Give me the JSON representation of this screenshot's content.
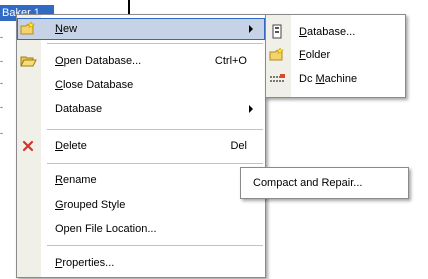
{
  "background": {
    "selected_node": "Baker 1"
  },
  "context_menu": {
    "items": [
      {
        "label": "New",
        "u": "N",
        "rest": "ew",
        "icon": "new-folder-icon",
        "submenu": true
      },
      {
        "label": "Open Database...",
        "u": "O",
        "rest": "pen Database...",
        "shortcut": "Ctrl+O",
        "icon": "open-folder-icon"
      },
      {
        "label": "Close Database",
        "u": "C",
        "rest": "lose Database"
      },
      {
        "label": "Database",
        "u": "",
        "rest": "Database",
        "submenu": true
      },
      {
        "label": "Delete",
        "u": "D",
        "rest": "elete",
        "shortcut": "Del",
        "icon": "delete-x-icon"
      },
      {
        "label": "Rename",
        "u": "R",
        "rest": "ename"
      },
      {
        "label": "Grouped Style",
        "u": "G",
        "rest": "rouped Style"
      },
      {
        "label": "Open File Location...",
        "u": "",
        "rest": "Open File Location..."
      },
      {
        "label": "Properties...",
        "u": "P",
        "rest": "roperties..."
      }
    ]
  },
  "new_submenu": {
    "items": [
      {
        "label": "Database...",
        "u": "D",
        "rest": "atabase...",
        "icon": "database-icon"
      },
      {
        "label": "Folder",
        "u": "F",
        "rest": "older",
        "icon": "folder-icon"
      },
      {
        "label": "Dc Machine",
        "pre": "Dc ",
        "u": "M",
        "rest": "achine",
        "icon": "dc-machine-icon"
      }
    ]
  },
  "database_submenu": {
    "items": [
      {
        "label": "Compact and Repair..."
      }
    ]
  },
  "colors": {
    "highlight": "#c6d3e7",
    "selection": "#316ac5",
    "gutter": "#f0efe8"
  }
}
